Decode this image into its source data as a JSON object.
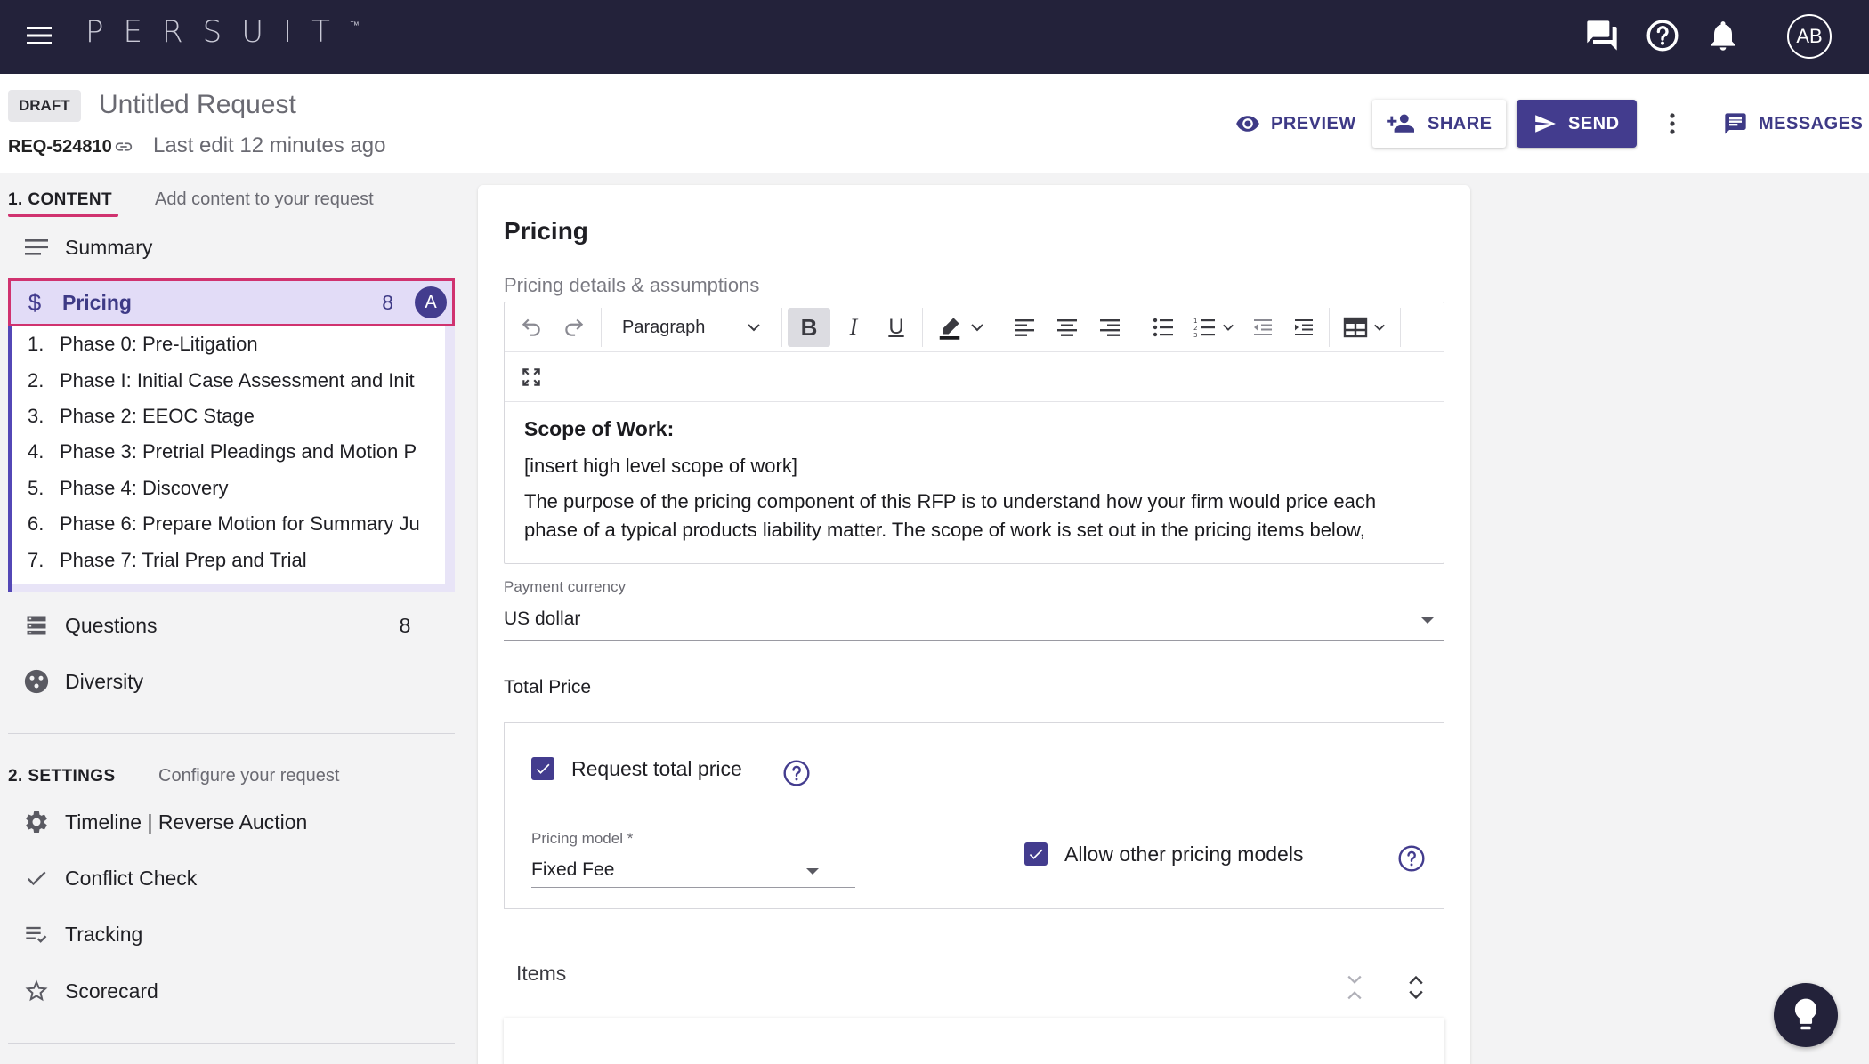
{
  "app": {
    "logo": "PERSUIT",
    "trademark": "™",
    "avatar_initials": "AB"
  },
  "request": {
    "status_badge": "DRAFT",
    "title": "Untitled Request",
    "id": "REQ-524810",
    "last_edit": "Last edit 12 minutes ago"
  },
  "header_actions": {
    "preview": "PREVIEW",
    "share": "SHARE",
    "send": "SEND",
    "messages": "MESSAGES"
  },
  "sidebar": {
    "content_section": {
      "title": "1. CONTENT",
      "subtitle": "Add content to your request"
    },
    "summary": "Summary",
    "pricing": {
      "label": "Pricing",
      "count": "8",
      "badge": "A",
      "icon": "$"
    },
    "phases": [
      {
        "num": "1.",
        "label": "Phase 0: Pre-Litigation"
      },
      {
        "num": "2.",
        "label": "Phase I: Initial Case Assessment and Init"
      },
      {
        "num": "3.",
        "label": "Phase 2: EEOC Stage"
      },
      {
        "num": "4.",
        "label": "Phase 3: Pretrial Pleadings and Motion P"
      },
      {
        "num": "5.",
        "label": "Phase 4: Discovery"
      },
      {
        "num": "6.",
        "label": "Phase 6: Prepare Motion for Summary Ju"
      },
      {
        "num": "7.",
        "label": "Phase 7: Trial Prep and Trial"
      }
    ],
    "questions": {
      "label": "Questions",
      "count": "8"
    },
    "diversity": "Diversity",
    "settings_section": {
      "title": "2. SETTINGS",
      "subtitle": "Configure your request"
    },
    "timeline": "Timeline | Reverse Auction",
    "conflict_check": "Conflict Check",
    "tracking": "Tracking",
    "scorecard": "Scorecard"
  },
  "main": {
    "title": "Pricing",
    "details_label": "Pricing details & assumptions",
    "toolbar": {
      "paragraph_style": "Paragraph"
    },
    "editor": {
      "heading": "Scope of Work:",
      "line1": "[insert high level scope of work]",
      "line2": "The purpose of the pricing component of this RFP is to understand how your firm would price each phase of a typical products liability matter. The scope of work is set out in the pricing items below,"
    },
    "currency": {
      "label": "Payment currency",
      "value": "US dollar"
    },
    "total_price": {
      "label": "Total Price",
      "request_total_price": "Request total price",
      "request_total_checked": true,
      "pricing_model_label": "Pricing model *",
      "pricing_model_value": "Fixed Fee",
      "allow_other": "Allow other pricing models",
      "allow_other_checked": true
    },
    "items_label": "Items"
  },
  "colors": {
    "navbar": "#23223a",
    "accent": "#433c8e",
    "highlight": "#d0326f",
    "active_bg": "#e2dcf7"
  }
}
